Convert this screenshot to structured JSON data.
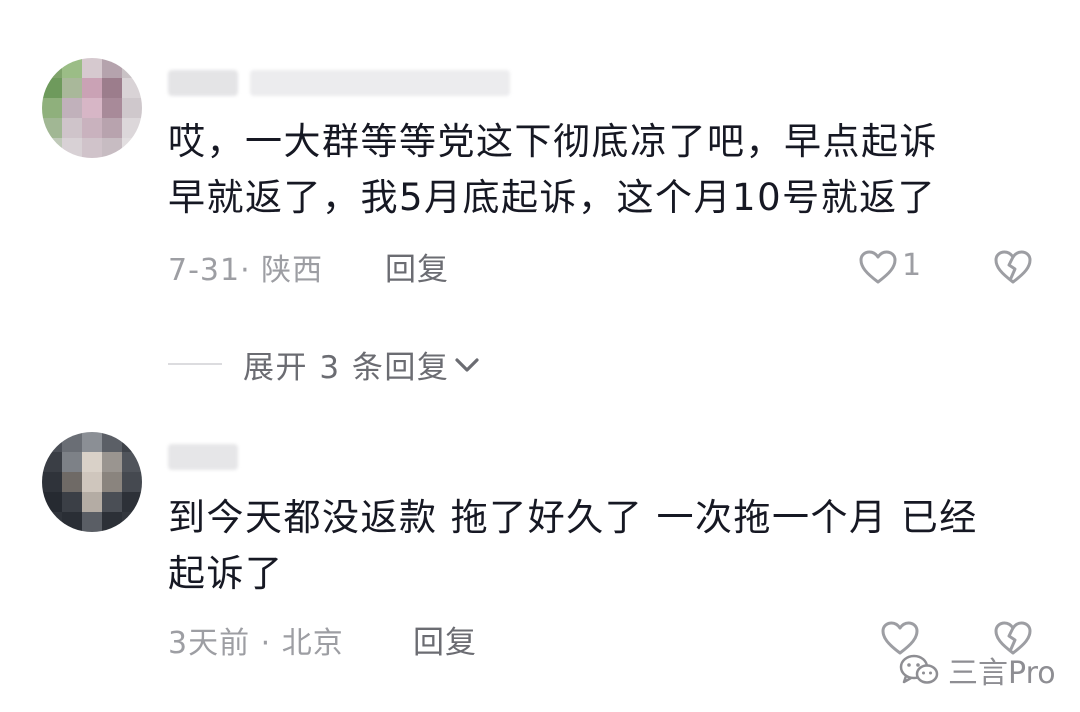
{
  "comments": [
    {
      "text": "哎，一大群等等党这下彻底凉了吧，早点起诉\n早就返了，我5月底起诉，这个月10号就返了",
      "date_location": "7-31· 陕西",
      "reply_label": "回复",
      "like_count": "1"
    },
    {
      "text": "到今天都没返款 拖了好久了 一次拖一个月 已经\n起诉了",
      "date_location": "3天前 · 北京",
      "reply_label": "回复",
      "like_count": ""
    }
  ],
  "expand_replies": {
    "label": "展开 3 条回复"
  },
  "watermark": {
    "text": "三言Pro"
  },
  "icons": {
    "like": "heart-outline-icon",
    "dislike": "broken-heart-icon",
    "expand": "chevron-down-icon",
    "watermark": "wechat-icon"
  }
}
